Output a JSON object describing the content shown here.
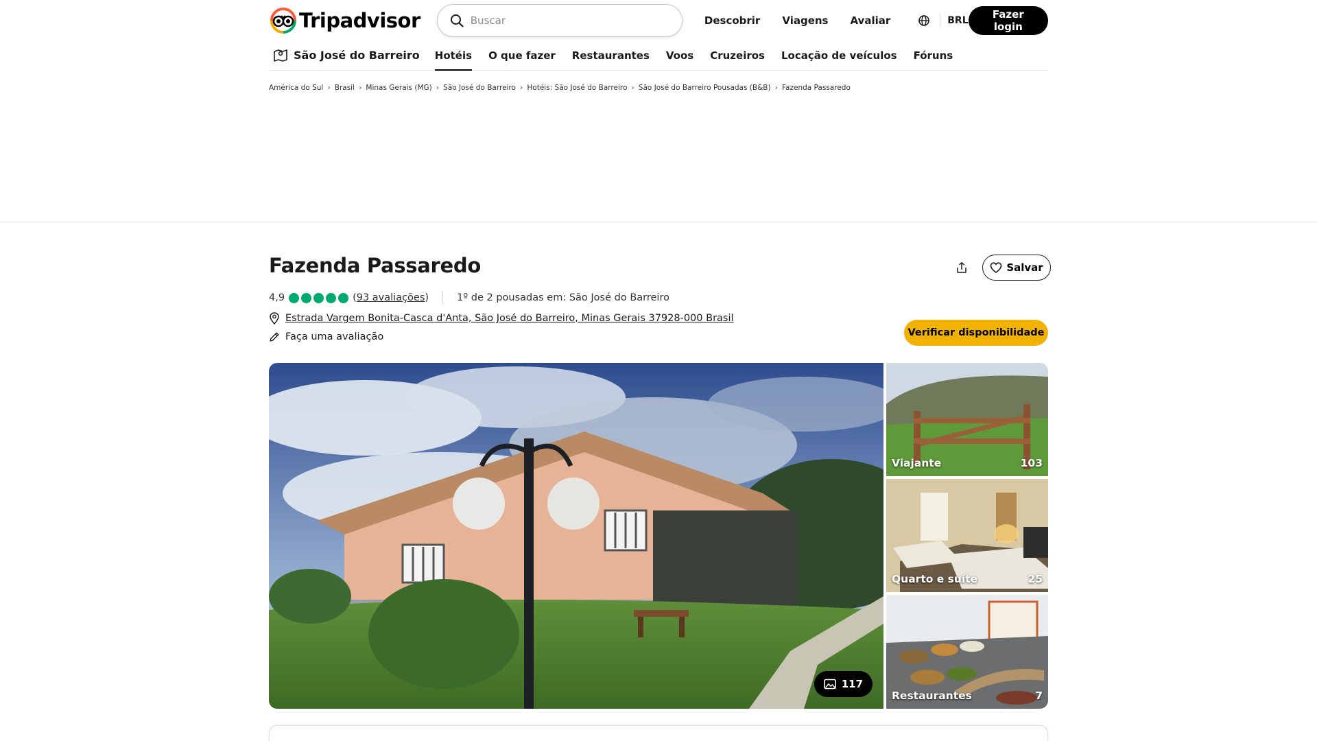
{
  "header": {
    "logo_text": "Tripadvisor",
    "search_placeholder": "Buscar",
    "links": [
      "Descobrir",
      "Viagens",
      "Avaliar"
    ],
    "currency": "BRL",
    "login_label": "Fazer login"
  },
  "subnav": {
    "location": "São José do Barreiro",
    "tabs": [
      {
        "label": "Hotéis",
        "active": true
      },
      {
        "label": "O que fazer",
        "active": false
      },
      {
        "label": "Restaurantes",
        "active": false
      },
      {
        "label": "Voos",
        "active": false
      },
      {
        "label": "Cruzeiros",
        "active": false
      },
      {
        "label": "Locação de veículos",
        "active": false
      },
      {
        "label": "Fóruns",
        "active": false
      }
    ]
  },
  "breadcrumb": [
    "América do Sul",
    "Brasil",
    "Minas Gerais (MG)",
    "São José do Barreiro",
    "Hotéis: São José do Barreiro",
    "São José do Barreiro Pousadas (B&B)",
    "Fazenda Passaredo"
  ],
  "listing": {
    "name": "Fazenda Passaredo",
    "share_icon": "share-icon",
    "save_label": "Salvar",
    "rating_value": "4,9",
    "rating_bubbles": 5,
    "reviews_label": "93 avaliações",
    "reviews_open": "(",
    "reviews_close": ")",
    "ranking": "1º de 2 pousadas em: São José do Barreiro",
    "address": "Estrada Vargem Bonita-Casca d'Anta, São José do Barreiro, Minas Gerais 37928-000 Brasil",
    "write_review": "Faça uma avaliação",
    "check_availability": "Verificar disponibilidade",
    "accent_color": "#f2b203",
    "rating_color": "#00aa6c"
  },
  "gallery": {
    "total_photos": "117",
    "thumbs": [
      {
        "caption": "Viajante",
        "count": "103"
      },
      {
        "caption": "Quarto e suíte",
        "count": "25"
      },
      {
        "caption": "Restaurantes",
        "count": "7"
      }
    ]
  }
}
